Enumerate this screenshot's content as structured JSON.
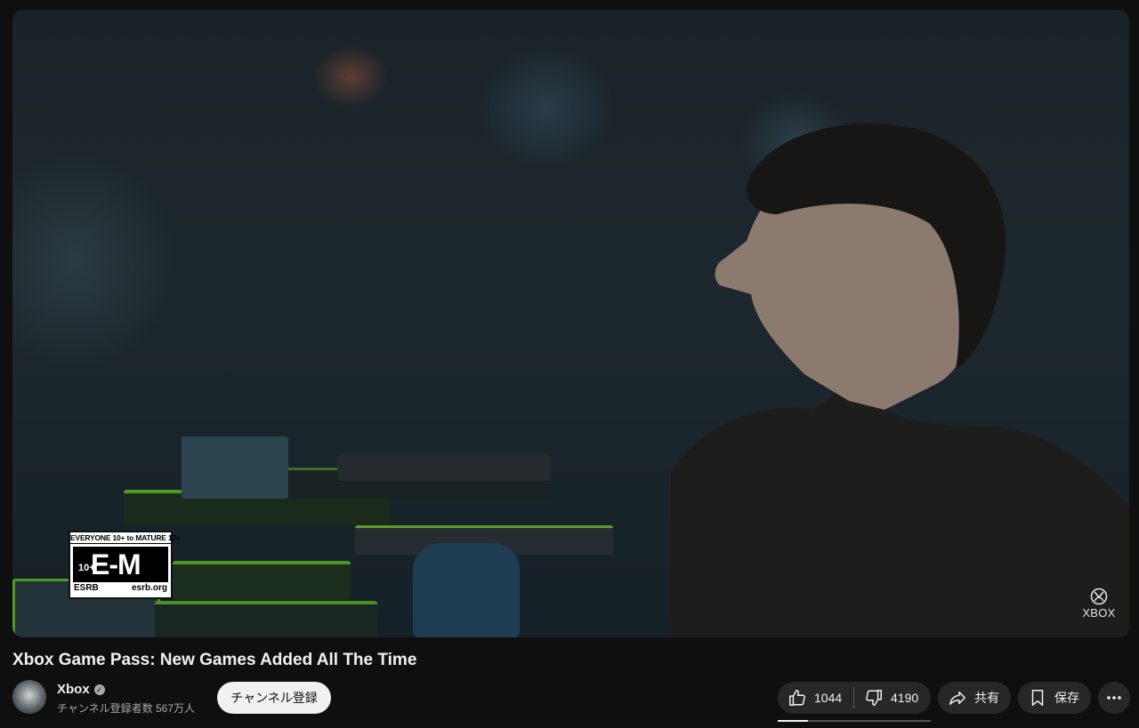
{
  "video": {
    "rating": {
      "top": "EVERYONE 10+ to MATURE 17+",
      "ten": "10+",
      "letters": "E-M",
      "org": "ESRB",
      "site": "esrb.org"
    },
    "watermark": "XBOX"
  },
  "title": "Xbox Game Pass: New Games Added All The Time",
  "channel": {
    "name": "Xbox",
    "verified_icon": "verified-check-icon",
    "subscribers": "チャンネル登録者数 567万人",
    "subscribe_label": "チャンネル登録"
  },
  "actions": {
    "likes": "1044",
    "dislikes": "4190",
    "like_ratio": 0.2,
    "share_label": "共有",
    "save_label": "保存",
    "icons": [
      "thumbs-up-icon",
      "thumbs-down-icon",
      "share-arrow-icon",
      "bookmark-icon",
      "more-horizontal-icon"
    ]
  },
  "colors": {
    "background": "#0f0f0f",
    "pill": "#272727",
    "subscribe_bg": "#f1f1f1",
    "text": "#f1f1f1",
    "muted": "#aaaaaa"
  }
}
